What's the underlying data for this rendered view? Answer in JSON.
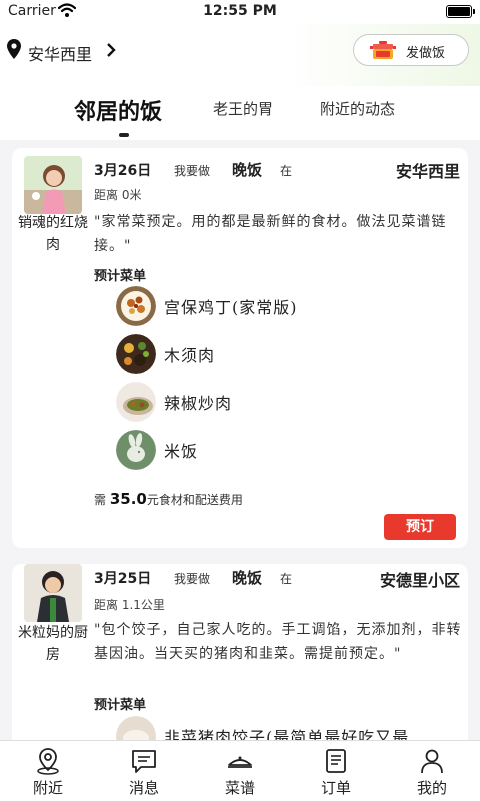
{
  "status": {
    "carrier": "Carrier",
    "time": "12:55 PM"
  },
  "header": {
    "location": "安华西里",
    "cook_button": "发做饭"
  },
  "tabs": [
    "邻居的饭",
    "老王的胃",
    "附近的动态"
  ],
  "cards": [
    {
      "cook_name": "销魂的红烧肉",
      "date": "3月26日",
      "want": "我要做",
      "meal": "晚饭",
      "at": "在",
      "place": "安华西里",
      "distance": "距离 0米",
      "description": "\"家常菜预定。用的都是最新鲜的食材。做法见菜谱链接。\"",
      "menu_title": "预计菜单",
      "dishes": [
        {
          "name": "宫保鸡丁(家常版)",
          "icon": "kungpao-chicken-photo"
        },
        {
          "name": "木须肉",
          "icon": "muxu-pork-photo"
        },
        {
          "name": "辣椒炒肉",
          "icon": "chili-pork-photo"
        },
        {
          "name": "米饭",
          "icon": "rice-placeholder-rabbit"
        }
      ],
      "price_prefix": "需",
      "price": "35.0",
      "price_suffix": "元食材和配送费用",
      "order_label": "预订"
    },
    {
      "cook_name": "米粒妈的厨房",
      "date": "3月25日",
      "want": "我要做",
      "meal": "晚饭",
      "at": "在",
      "place": "安德里小区",
      "distance": "距离 1.1公里",
      "description": "\"包个饺子，自己家人吃的。手工调馅，无添加剂，非转基因油。当天买的猪肉和韭菜。需提前预定。\"",
      "menu_title": "预计菜单",
      "dishes": [
        {
          "name": "韭菜猪肉饺子(最简单最好吃又最",
          "icon": "dumpling-photo"
        }
      ]
    }
  ],
  "nav": [
    "附近",
    "消息",
    "菜谱",
    "订单",
    "我的"
  ],
  "colors": {
    "accent": "#e8392c",
    "header_tint": "#eef8e6"
  }
}
